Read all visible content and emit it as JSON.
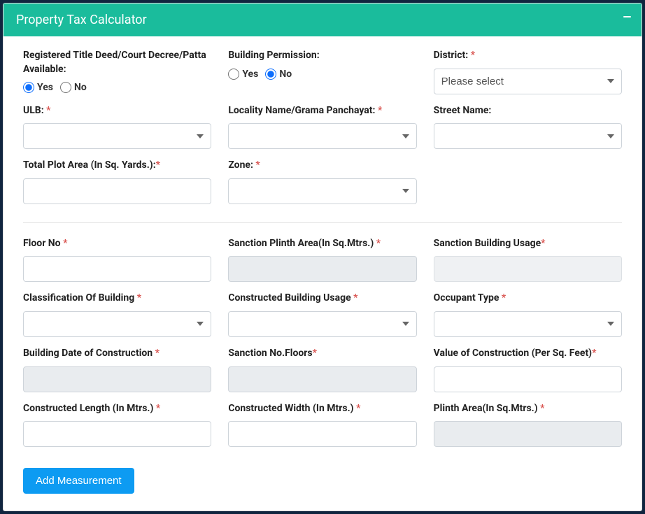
{
  "header": {
    "title": "Property Tax Calculator"
  },
  "options": {
    "yes": "Yes",
    "no": "No",
    "pleaseSelect": "Please select"
  },
  "section1": {
    "titleDeed": {
      "label": "Registered Title Deed/Court Decree/Patta Available:",
      "selected": "yes"
    },
    "buildingPermission": {
      "label": "Building Permission:",
      "selected": "no"
    },
    "district": {
      "label": "District:"
    },
    "ulb": {
      "label": "ULB:"
    },
    "locality": {
      "label": "Locality Name/Grama Panchayat:"
    },
    "streetName": {
      "label": "Street Name:"
    },
    "totalPlotArea": {
      "label": "Total Plot Area (In Sq. Yards.):"
    },
    "zone": {
      "label": "Zone:"
    }
  },
  "section2": {
    "floorNo": {
      "label": "Floor No"
    },
    "sanctionPlinthArea": {
      "label": "Sanction Plinth Area(In Sq.Mtrs.)"
    },
    "sanctionBuildingUsage": {
      "label": "Sanction Building Usage"
    },
    "classificationBuilding": {
      "label": "Classification Of Building"
    },
    "constructedBuildingUsage": {
      "label": "Constructed Building Usage"
    },
    "occupantType": {
      "label": "Occupant Type"
    },
    "buildingDate": {
      "label": "Building Date of Construction"
    },
    "sanctionNoFloors": {
      "label": "Sanction No.Floors"
    },
    "valueConstruction": {
      "label": "Value of Construction (Per Sq. Feet)"
    },
    "constructedLength": {
      "label": "Constructed Length (In Mtrs.)"
    },
    "constructedWidth": {
      "label": "Constructed Width (In Mtrs.)"
    },
    "plinthArea": {
      "label": "Plinth Area(In Sq.Mtrs.)"
    }
  },
  "buttons": {
    "addMeasurement": "Add Measurement"
  }
}
